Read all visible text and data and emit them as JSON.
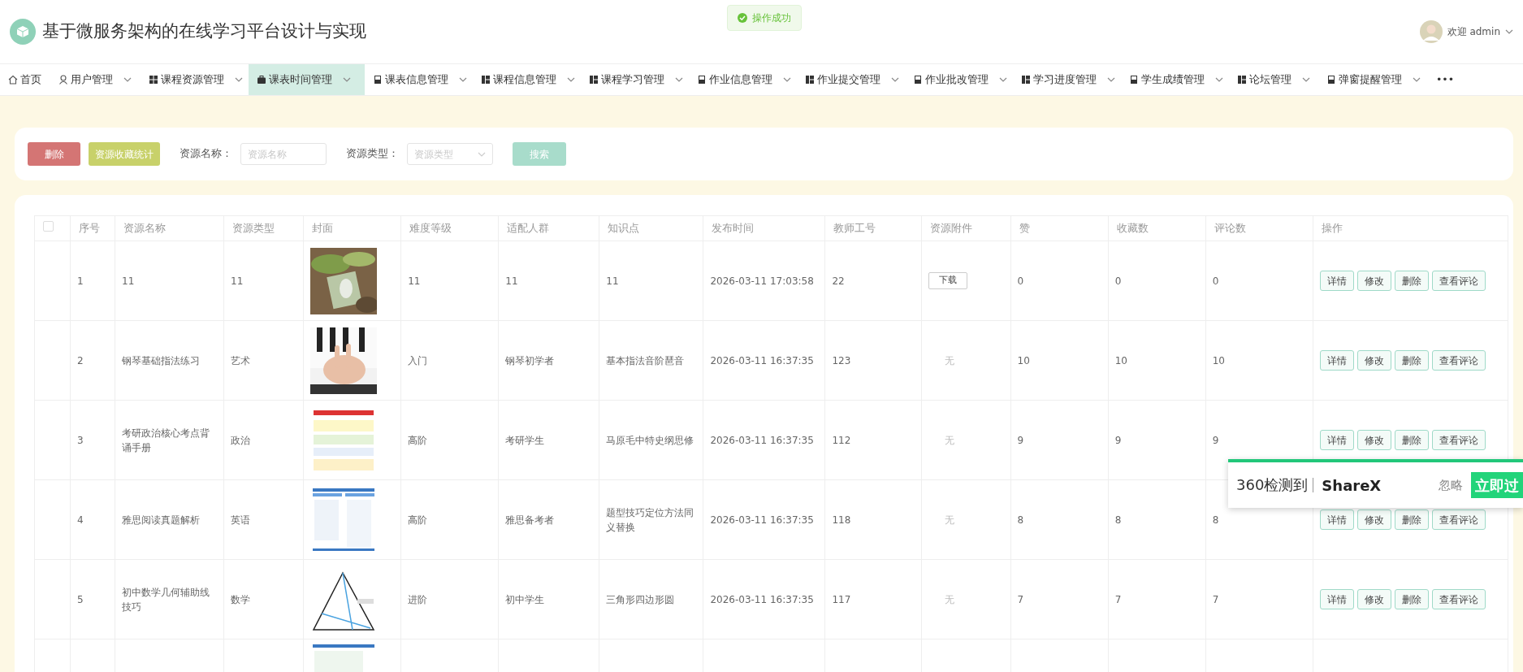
{
  "header": {
    "title": "基于微服务架构的在线学习平台设计与实现",
    "toast": "操作成功",
    "greeting": "欢迎 admin"
  },
  "nav": [
    {
      "label": "首页",
      "selected": false,
      "dropdown": false
    },
    {
      "label": "用户管理",
      "selected": false,
      "dropdown": true
    },
    {
      "label": "课程资源管理",
      "selected": false,
      "dropdown": true
    },
    {
      "label": "课表时间管理",
      "selected": true,
      "dropdown": true
    },
    {
      "label": "课表信息管理",
      "selected": false,
      "dropdown": true
    },
    {
      "label": "课程信息管理",
      "selected": false,
      "dropdown": true
    },
    {
      "label": "课程学习管理",
      "selected": false,
      "dropdown": true
    },
    {
      "label": "作业信息管理",
      "selected": false,
      "dropdown": true
    },
    {
      "label": "作业提交管理",
      "selected": false,
      "dropdown": true
    },
    {
      "label": "作业批改管理",
      "selected": false,
      "dropdown": true
    },
    {
      "label": "学习进度管理",
      "selected": false,
      "dropdown": true
    },
    {
      "label": "学生成绩管理",
      "selected": false,
      "dropdown": true
    },
    {
      "label": "论坛管理",
      "selected": false,
      "dropdown": true
    },
    {
      "label": "弹窗提醒管理",
      "selected": false,
      "dropdown": true
    },
    {
      "label": "•••",
      "selected": false,
      "dropdown": false
    }
  ],
  "toolbar": {
    "buttons": [
      {
        "label": "删除",
        "kind": "danger"
      },
      {
        "label": "资源收藏统计",
        "kind": "stats"
      }
    ],
    "filters": [
      {
        "label": "资源名称：",
        "kind": "input",
        "placeholder": "资源名称"
      },
      {
        "label": "资源类型：",
        "kind": "select",
        "placeholder": "资源类型"
      }
    ],
    "search_button": "搜索"
  },
  "table": {
    "select_all": {
      "checked": false
    },
    "columns": [
      "序号",
      "资源名称",
      "资源类型",
      "封面",
      "难度等级",
      "适配人群",
      "知识点",
      "发布时间",
      "教师工号",
      "资源附件",
      "赞",
      "收藏数",
      "评论数",
      "操作"
    ],
    "rows": [
      {
        "seq": "1",
        "name": "11",
        "type": "11",
        "cover": {
          "kind": "picture"
        },
        "level": "11",
        "audience": "11",
        "knowledge": "11",
        "time": "2026-03-11 17:03:58",
        "teacher": "22",
        "attachment": {
          "kind": "button",
          "text": "下载"
        },
        "likes": "0",
        "favorites": "0",
        "comments": "0",
        "actions": [
          "详情",
          "修改",
          "删除",
          "查看评论"
        ]
      },
      {
        "seq": "2",
        "name": "钢琴基础指法练习",
        "type": "艺术",
        "cover": {
          "kind": "picture"
        },
        "level": "入门",
        "audience": "钢琴初学者",
        "knowledge": "基本指法音阶琶音",
        "time": "2026-03-11 16:37:35",
        "teacher": "123",
        "attachment": {
          "kind": "none",
          "text": "无"
        },
        "likes": "10",
        "favorites": "10",
        "comments": "10",
        "actions": [
          "详情",
          "修改",
          "删除",
          "查看评论"
        ]
      },
      {
        "seq": "3",
        "name": "考研政治核心考点背诵手册",
        "type": "政治",
        "cover": {
          "kind": "picture"
        },
        "level": "高阶",
        "audience": "考研学生",
        "knowledge": "马原毛中特史纲思修",
        "time": "2026-03-11 16:37:35",
        "teacher": "112",
        "attachment": {
          "kind": "none",
          "text": "无"
        },
        "likes": "9",
        "favorites": "9",
        "comments": "9",
        "actions": [
          "详情",
          "修改",
          "删除",
          "查看评论"
        ]
      },
      {
        "seq": "4",
        "name": "雅思阅读真题解析",
        "type": "英语",
        "cover": {
          "kind": "picture"
        },
        "level": "高阶",
        "audience": "雅思备考者",
        "knowledge": "题型技巧定位方法同义替换",
        "time": "2026-03-11 16:37:35",
        "teacher": "118",
        "attachment": {
          "kind": "none",
          "text": "无"
        },
        "likes": "8",
        "favorites": "8",
        "comments": "8",
        "actions": [
          "详情",
          "修改",
          "删除",
          "查看评论"
        ]
      },
      {
        "seq": "5",
        "name": "初中数学几何辅助线技巧",
        "type": "数学",
        "cover": {
          "kind": "picture"
        },
        "level": "进阶",
        "audience": "初中学生",
        "knowledge": "三角形四边形圆",
        "time": "2026-03-11 16:37:35",
        "teacher": "117",
        "attachment": {
          "kind": "none",
          "text": "无"
        },
        "likes": "7",
        "favorites": "7",
        "comments": "7",
        "actions": [
          "详情",
          "修改",
          "删除",
          "查看评论"
        ]
      },
      {
        "cover": {
          "kind": "picture"
        }
      }
    ]
  },
  "popup": {
    "text": "360检测到",
    "app": "ShareX",
    "ignore": "忽略",
    "action": "立即过"
  }
}
